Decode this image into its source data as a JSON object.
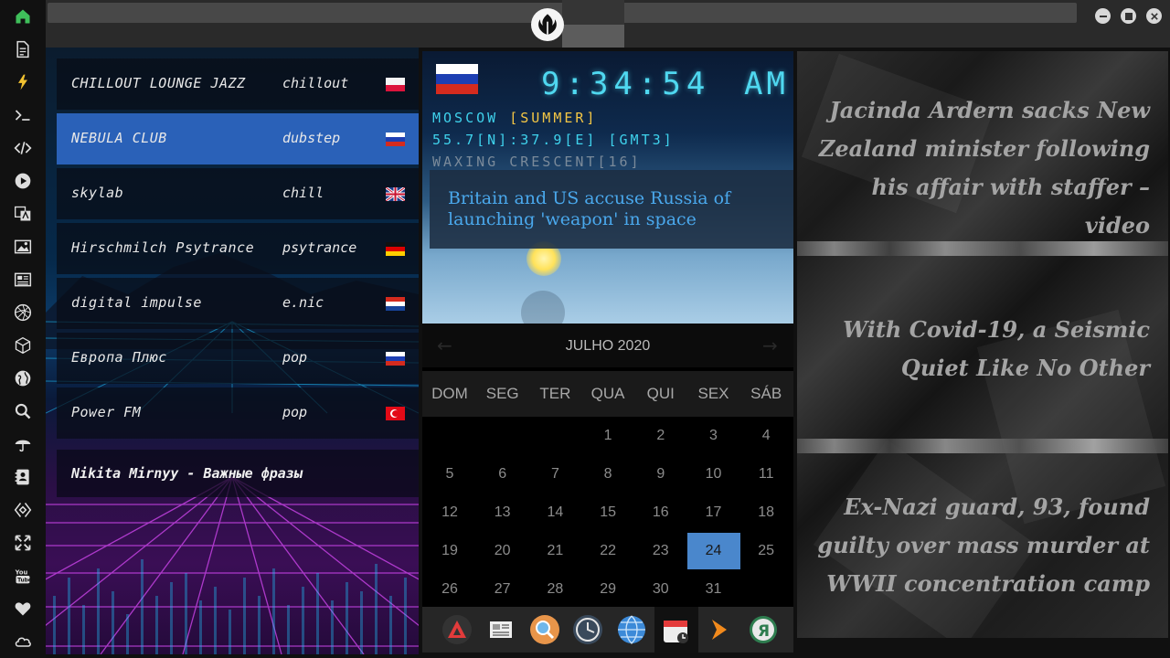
{
  "top_bar": {
    "logo": "rebel-alliance-icon"
  },
  "sidebar": {
    "icons": [
      "home-icon",
      "document-icon",
      "lightning-icon",
      "terminal-icon",
      "code-icon",
      "play-icon",
      "translate-icon",
      "image-icon",
      "news-icon",
      "aperture-icon",
      "cube-icon",
      "globe-icon",
      "search-icon",
      "umbrella-icon",
      "contact-icon",
      "bracket-diamond-icon",
      "expand-icon",
      "youtube-icon",
      "heart-icon",
      "cloud-icon"
    ],
    "active_color": "#3fbf5a"
  },
  "radio": {
    "stations": [
      {
        "name": "CHILLOUT LOUNGE JAZZ",
        "genre": "chillout",
        "flag": "poland"
      },
      {
        "name": "NEBULA CLUB",
        "genre": "dubstep",
        "flag": "russia"
      },
      {
        "name": "skylab",
        "genre": "chill",
        "flag": "uk"
      },
      {
        "name": "Hirschmilch Psytrance",
        "genre": "psytrance",
        "flag": "germany"
      },
      {
        "name": "digital impulse",
        "genre": "e.nic",
        "flag": "croatia"
      },
      {
        "name": "Европа Плюс",
        "genre": "pop",
        "flag": "russia"
      },
      {
        "name": "Power FM",
        "genre": "pop",
        "flag": "turkey"
      }
    ],
    "now_playing": "Nikita Mirnyy - Важные фразы",
    "active_color": "#2a61b8"
  },
  "clock": {
    "time": "9:34:54",
    "ampm": "AM",
    "city": "MOSCOW ",
    "season": "[SUMMER]",
    "coords": "55.7[N]:37.9[E] [GMT3]",
    "moon": "WAXING CRESCENT[16]",
    "headline": "Britain and US accuse Russia of launching 'weapon' in space",
    "flag": "russia"
  },
  "calendar": {
    "month": "JULHO 2020",
    "weekdays": [
      "DOM",
      "SEG",
      "TER",
      "QUA",
      "QUI",
      "SEX",
      "SÁB"
    ],
    "first_weekday_index": 3,
    "days_in_month": 31,
    "today": 24,
    "today_color": "#4a87cc"
  },
  "dock": {
    "icons": [
      "red-triangle-icon",
      "newspaper-icon",
      "search-icon",
      "clock-icon",
      "globe-icon",
      "calendar-icon",
      "play-arrow-icon",
      "yandex-icon"
    ]
  },
  "news": {
    "headlines": [
      "Jacinda Ardern sacks New Zealand minister following his affair with staffer – video",
      "With Covid-19, a Seismic Quiet Like No Other",
      "Ex-Nazi guard, 93, found guilty over mass murder at WWII concentration camp"
    ]
  }
}
